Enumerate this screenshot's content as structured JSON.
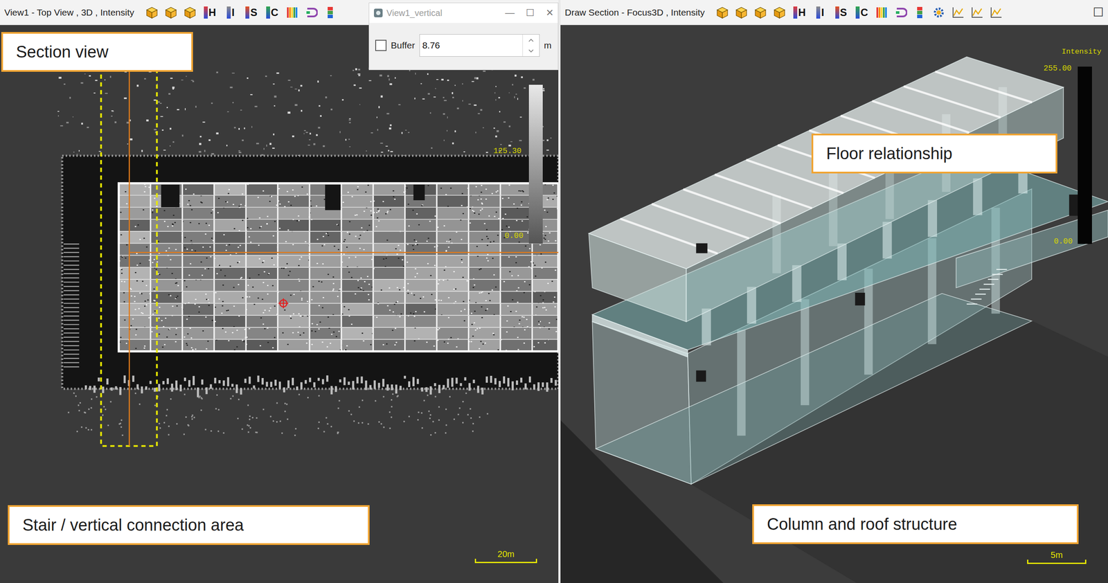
{
  "left_panel": {
    "title": "View1 - Top View , 3D , Intensity",
    "toolbar": [
      {
        "kind": "cube"
      },
      {
        "kind": "cube"
      },
      {
        "kind": "cube"
      },
      {
        "kind": "letter",
        "label": "H",
        "color": "#e03a3a"
      },
      {
        "kind": "letter",
        "label": "I",
        "color": "#8a8a8a"
      },
      {
        "kind": "letter",
        "label": "S",
        "color": "#e8501e"
      },
      {
        "kind": "letter",
        "label": "C",
        "color": "#2fa84a"
      },
      {
        "kind": "bars"
      },
      {
        "kind": "loop"
      },
      {
        "kind": "rgb"
      }
    ],
    "colorbar": {
      "labels": [
        "125.30",
        "0.00"
      ]
    },
    "scale_bar": "20m",
    "annotations": [
      {
        "label": "Section view"
      },
      {
        "label": "Stair / vertical connection area"
      }
    ]
  },
  "dialog": {
    "title": "View1_vertical",
    "controls": [
      "—",
      "☐",
      "✕"
    ],
    "buffer": {
      "label": "Buffer",
      "checked": false,
      "value": "8.76",
      "unit": "m"
    }
  },
  "right_panel": {
    "title": "Draw Section - Focus3D , Intensity",
    "toolbar": [
      {
        "kind": "cube"
      },
      {
        "kind": "cube"
      },
      {
        "kind": "cube"
      },
      {
        "kind": "cube"
      },
      {
        "kind": "letter",
        "label": "H",
        "color": "#e03a3a"
      },
      {
        "kind": "letter",
        "label": "I",
        "color": "#8a8a8a"
      },
      {
        "kind": "letter",
        "label": "S",
        "color": "#e8501e"
      },
      {
        "kind": "letter",
        "label": "C",
        "color": "#2fa84a"
      },
      {
        "kind": "bars"
      },
      {
        "kind": "loop"
      },
      {
        "kind": "rgb"
      },
      {
        "kind": "gear"
      },
      {
        "kind": "chart"
      },
      {
        "kind": "chart"
      },
      {
        "kind": "chart"
      }
    ],
    "window_controls": [
      "☐"
    ],
    "colorbar": {
      "title": "Intensity",
      "max": "255.00",
      "min": "0.00"
    },
    "scale_bar": "5m",
    "annotations": [
      {
        "label": "Floor relationship"
      },
      {
        "label": "Column and roof structure"
      }
    ]
  }
}
